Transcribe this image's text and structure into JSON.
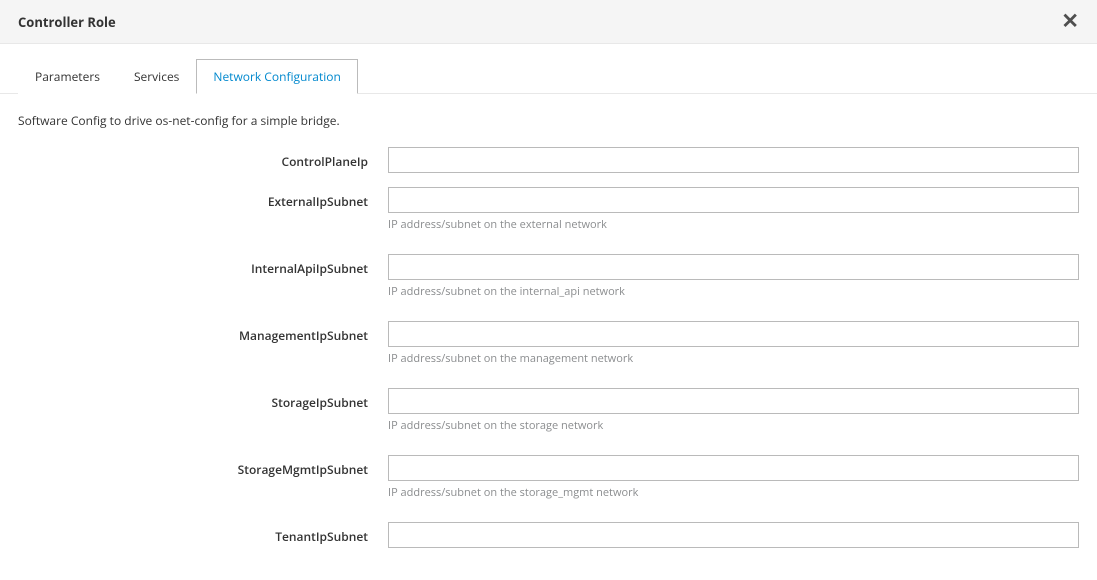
{
  "header": {
    "title": "Controller Role"
  },
  "tabs": [
    {
      "label": "Parameters",
      "active": false
    },
    {
      "label": "Services",
      "active": false
    },
    {
      "label": "Network Configuration",
      "active": true
    }
  ],
  "description": "Software Config to drive os-net-config for a simple bridge.",
  "fields": [
    {
      "label": "ControlPlaneIp",
      "value": "",
      "help": ""
    },
    {
      "label": "ExternalIpSubnet",
      "value": "",
      "help": "IP address/subnet on the external network"
    },
    {
      "label": "InternalApiIpSubnet",
      "value": "",
      "help": "IP address/subnet on the internal_api network"
    },
    {
      "label": "ManagementIpSubnet",
      "value": "",
      "help": "IP address/subnet on the management network"
    },
    {
      "label": "StorageIpSubnet",
      "value": "",
      "help": "IP address/subnet on the storage network"
    },
    {
      "label": "StorageMgmtIpSubnet",
      "value": "",
      "help": "IP address/subnet on the storage_mgmt network"
    },
    {
      "label": "TenantIpSubnet",
      "value": "",
      "help": ""
    }
  ]
}
